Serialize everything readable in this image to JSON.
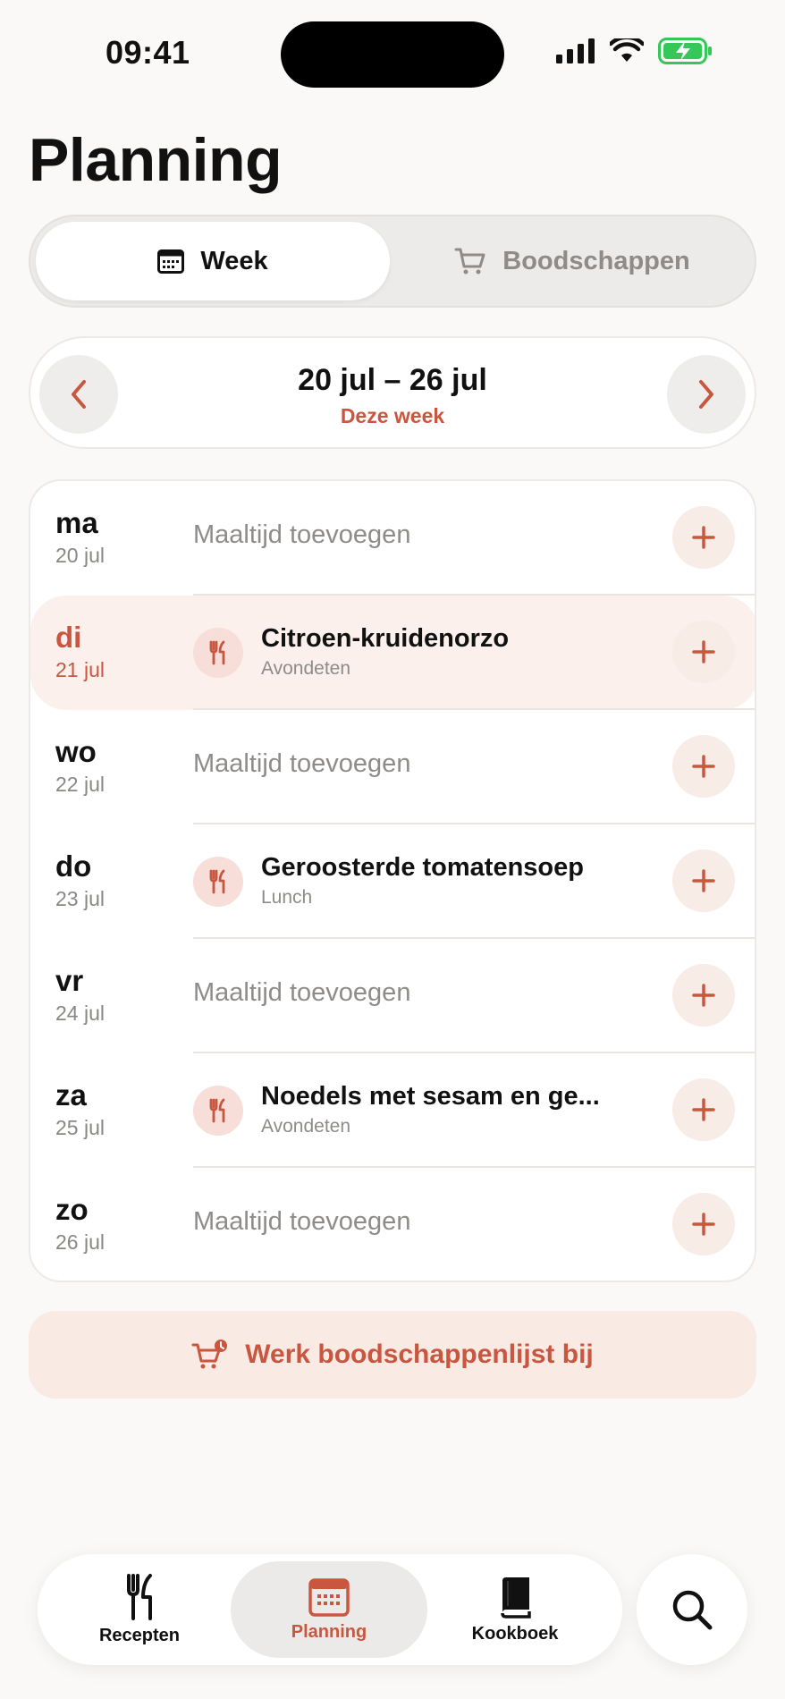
{
  "status": {
    "time": "09:41"
  },
  "page": {
    "title": "Planning"
  },
  "segments": {
    "week": "Week",
    "shopping": "Boodschappen"
  },
  "week_nav": {
    "range": "20 jul – 26 jul",
    "subtitle": "Deze week"
  },
  "days": [
    {
      "name": "ma",
      "date": "20 jul",
      "placeholder": "Maaltijd toevoegen"
    },
    {
      "name": "di",
      "date": "21 jul",
      "meal": "Citroen-kruidenorzo",
      "type": "Avondeten"
    },
    {
      "name": "wo",
      "date": "22 jul",
      "placeholder": "Maaltijd toevoegen"
    },
    {
      "name": "do",
      "date": "23 jul",
      "meal": "Geroosterde tomatensoep",
      "type": "Lunch"
    },
    {
      "name": "vr",
      "date": "24 jul",
      "placeholder": "Maaltijd toevoegen"
    },
    {
      "name": "za",
      "date": "25 jul",
      "meal": "Noedels met sesam en ge...",
      "type": "Avondeten"
    },
    {
      "name": "zo",
      "date": "26 jul",
      "placeholder": "Maaltijd toevoegen"
    }
  ],
  "actions": {
    "update_shopping": "Werk boodschappenlijst bij"
  },
  "tabs": {
    "recipes": "Recepten",
    "planning": "Planning",
    "cookbook": "Kookboek"
  },
  "colors": {
    "accent": "#C9563E",
    "background": "#FBF9F7"
  }
}
